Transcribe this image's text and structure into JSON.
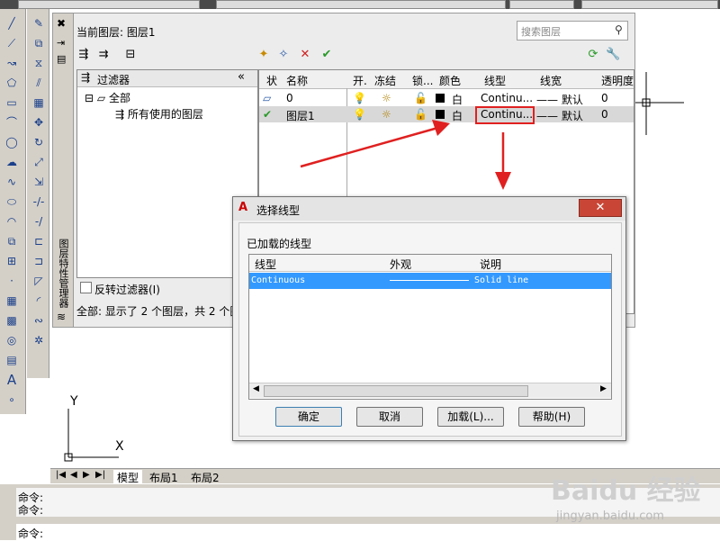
{
  "layer_manager": {
    "current_layer_label": "当前图层: 图层1",
    "search_placeholder": "搜索图层",
    "vertical_title": "图层特性管理器",
    "filter_header": "过滤器",
    "filter_collapse": "«",
    "tree": {
      "root": "全部",
      "child": "所有使用的图层"
    },
    "invert_filter_label": "反转过滤器(I)",
    "status_text": "全部: 显示了 2 个图层，共 2 个图",
    "columns": [
      "状",
      "名称",
      "开.",
      "冻结",
      "锁...",
      "颜色",
      "线型",
      "线宽",
      "透明度"
    ],
    "rows": [
      {
        "status_icon": "layer-icon",
        "name": "0",
        "color": "白",
        "linetype": "Continu...",
        "lineweight": "—— 默认",
        "transparency": "0"
      },
      {
        "status_icon": "check-icon",
        "name": "图层1",
        "color": "白",
        "linetype": "Continu...",
        "lineweight": "—— 默认",
        "transparency": "0"
      }
    ]
  },
  "dialog": {
    "title": "选择线型",
    "close_label": "✕",
    "loaded_label": "已加载的线型",
    "columns": [
      "线型",
      "外观",
      "说明"
    ],
    "rows": [
      {
        "linetype": "Continuous",
        "description": "Solid line"
      }
    ],
    "buttons": {
      "ok": "确定",
      "cancel": "取消",
      "load": "加载(L)...",
      "help": "帮助(H)"
    }
  },
  "drawing": {
    "ucs_y": "Y",
    "ucs_x": "X"
  },
  "layout_tabs": [
    "模型",
    "布局1",
    "布局2"
  ],
  "command": {
    "line1": "命令:",
    "line2": "命令:",
    "prompt": "命令:"
  },
  "watermark": {
    "logo": "Baidu 经验",
    "url": "jingyan.baidu.com"
  },
  "colors": {
    "accent_red": "#e02020",
    "selection_blue": "#3399ff",
    "toolbar_gray": "#d4d0c8"
  }
}
